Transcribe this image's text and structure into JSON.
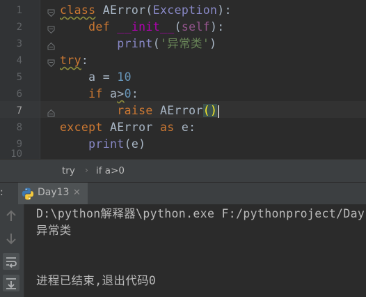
{
  "editor": {
    "lines": [
      {
        "n": "1",
        "parts": [
          [
            "class",
            "kw warn"
          ],
          [
            " ",
            ""
          ],
          [
            "AError",
            ""
          ],
          [
            "(",
            ""
          ],
          [
            "Exception",
            "bi"
          ],
          [
            "):",
            ""
          ]
        ]
      },
      {
        "n": "2",
        "parts": [
          [
            "    ",
            ""
          ],
          [
            "def",
            "kw"
          ],
          [
            " ",
            ""
          ],
          [
            "__init__",
            "fn"
          ],
          [
            "(",
            ""
          ],
          [
            "self",
            "sf"
          ],
          [
            "):",
            ""
          ]
        ]
      },
      {
        "n": "3",
        "parts": [
          [
            "        ",
            ""
          ],
          [
            "print",
            "bi"
          ],
          [
            "(",
            ""
          ],
          [
            "'异常类'",
            "str"
          ],
          [
            ")",
            ""
          ]
        ]
      },
      {
        "n": "4",
        "parts": [
          [
            "try",
            "kw warn"
          ],
          [
            ":",
            ""
          ]
        ]
      },
      {
        "n": "5",
        "parts": [
          [
            "    a = ",
            ""
          ],
          [
            "10",
            "num"
          ]
        ]
      },
      {
        "n": "6",
        "parts": [
          [
            "    ",
            ""
          ],
          [
            "if",
            "kw"
          ],
          [
            " a",
            ""
          ],
          [
            ">",
            "warn"
          ],
          [
            "0",
            "num"
          ],
          [
            ":",
            ""
          ]
        ]
      },
      {
        "n": "7",
        "parts": [
          [
            "        ",
            ""
          ],
          [
            "raise",
            "kw"
          ],
          [
            " AError",
            ""
          ],
          [
            "()",
            "paren"
          ]
        ]
      },
      {
        "n": "8",
        "parts": [
          [
            "except",
            "kw"
          ],
          [
            " AError ",
            ""
          ],
          [
            "as",
            "kw"
          ],
          [
            " e:",
            ""
          ]
        ]
      },
      {
        "n": "9",
        "parts": [
          [
            "    ",
            ""
          ],
          [
            "print",
            "bi"
          ],
          [
            "(e)",
            ""
          ]
        ]
      }
    ],
    "partial_line_number": "10",
    "active_line": "7"
  },
  "breadcrumb": {
    "items": [
      "try",
      "if a>0"
    ],
    "separator": "›"
  },
  "run_panel": {
    "label": ":",
    "tab_title": "Day13",
    "tab_close": "✕",
    "tools": [
      "up-arrow-icon",
      "down-arrow-icon",
      "soft-wrap-icon",
      "scroll-to-end-icon"
    ]
  },
  "console": {
    "lines": [
      "D:\\python解释器\\python.exe F:/pythonproject/Day",
      "异常类",
      "",
      "",
      "进程已结束,退出代码0"
    ]
  },
  "colors": {
    "background": "#2b2b2b",
    "gutter": "#313335",
    "keyword": "#cc7832",
    "string": "#6a8759",
    "number": "#6897bb",
    "builtin": "#8888c6",
    "magic": "#b200b2",
    "self": "#94558d",
    "text": "#a9b7c6"
  }
}
